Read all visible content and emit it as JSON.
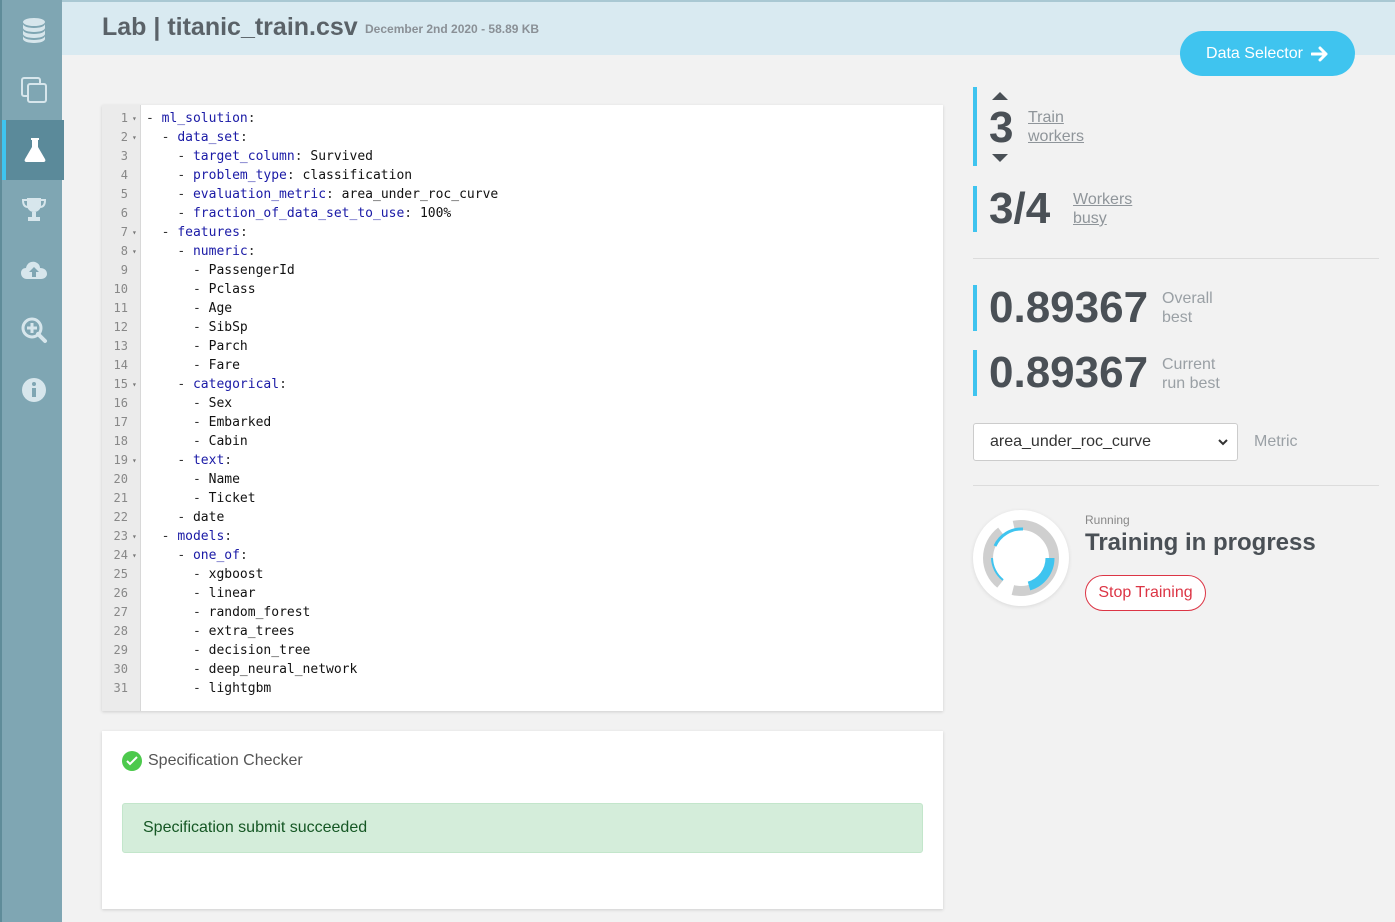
{
  "header": {
    "title": "Lab | titanic_train.csv",
    "meta": "December 2nd 2020 - 58.89 KB"
  },
  "data_selector": {
    "label": "Data Selector"
  },
  "sidebar": {
    "items": [
      {
        "name": "database-icon",
        "active": false
      },
      {
        "name": "copy-icon",
        "active": false
      },
      {
        "name": "flask-icon",
        "active": true
      },
      {
        "name": "trophy-icon",
        "active": false
      },
      {
        "name": "cloud-upload-icon",
        "active": false
      },
      {
        "name": "zoom-in-icon",
        "active": false
      },
      {
        "name": "info-icon",
        "active": false
      }
    ]
  },
  "editor": {
    "lines": [
      "- ml_solution:",
      "  - data_set:",
      "    - target_column: Survived",
      "    - problem_type: classification",
      "    - evaluation_metric: area_under_roc_curve",
      "    - fraction_of_data_set_to_use: 100%",
      "  - features:",
      "    - numeric:",
      "      - PassengerId",
      "      - Pclass",
      "      - Age",
      "      - SibSp",
      "      - Parch",
      "      - Fare",
      "    - categorical:",
      "      - Sex",
      "      - Embarked",
      "      - Cabin",
      "    - text:",
      "      - Name",
      "      - Ticket",
      "    - date",
      "  - models:",
      "    - one_of:",
      "      - xgboost",
      "      - linear",
      "      - random_forest",
      "      - extra_trees",
      "      - decision_tree",
      "      - deep_neural_network",
      "      - lightgbm"
    ],
    "foldable_lines": [
      1,
      2,
      7,
      8,
      15,
      19,
      23,
      24
    ]
  },
  "spec_checker": {
    "title": "Specification Checker",
    "message": "Specification submit succeeded"
  },
  "stats": {
    "train_workers": {
      "value": "3",
      "label_1": "Train",
      "label_2": "workers"
    },
    "workers_busy": {
      "value": "3/4",
      "label_1": "Workers",
      "label_2": "busy"
    },
    "overall_best": {
      "value": "0.89367",
      "label_1": "Overall",
      "label_2": "best"
    },
    "current_best": {
      "value": "0.89367",
      "label_1": "Current",
      "label_2": "run best"
    }
  },
  "metric": {
    "selected": "area_under_roc_curve",
    "label": "Metric"
  },
  "training": {
    "status": "Running",
    "title": "Training in progress",
    "stop_label": "Stop Training"
  },
  "colors": {
    "accent": "#3fc4ef",
    "sidebar": "#7fa6b3",
    "danger": "#dc3545",
    "success_bg": "#d4edda"
  }
}
